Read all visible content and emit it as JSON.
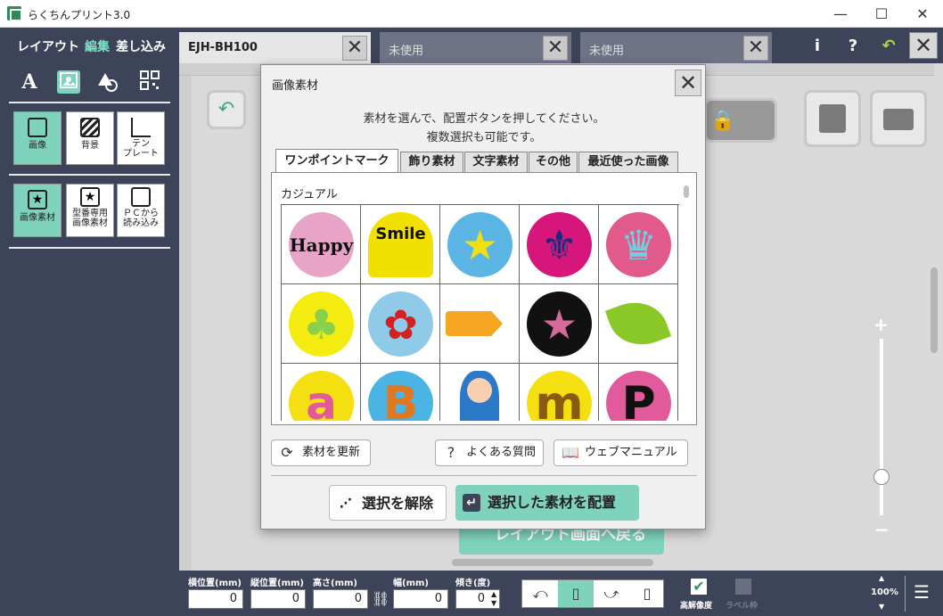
{
  "app": {
    "title": "らくちんプリント3.0"
  },
  "window_controls": {
    "minimize": "—",
    "maximize": "☐",
    "close": "✕"
  },
  "modes": [
    "レイアウト",
    "編集",
    "差し込み"
  ],
  "doc_tabs": [
    {
      "label": "EJH-BH100",
      "active": true
    },
    {
      "label": "未使用",
      "active": false
    },
    {
      "label": "未使用",
      "active": false
    }
  ],
  "top_icons": {
    "info": "i",
    "help": "?",
    "undo": "↶",
    "close": "✕"
  },
  "tools": {
    "text": "A"
  },
  "tiles_row1": [
    {
      "label": "画像",
      "icon": "image-icon",
      "active": true
    },
    {
      "label": "背景",
      "icon": "background-icon",
      "active": false
    },
    {
      "label": "テン\nプレート",
      "icon": "template-icon",
      "active": false
    }
  ],
  "tiles_row2": [
    {
      "label": "画像素材",
      "icon": "star-icon",
      "active": true
    },
    {
      "label": "型番専用\n画像素材",
      "icon": "star-icon",
      "active": false
    },
    {
      "label": "ＰＣから\n読み込み",
      "icon": "pc-icon",
      "active": false
    }
  ],
  "behind_button": "レイアウト画面へ戻る",
  "bottom": {
    "fields": [
      {
        "label": "横位置(mm)",
        "value": "0"
      },
      {
        "label": "縦位置(mm)",
        "value": "0"
      },
      {
        "label": "高さ(mm)",
        "value": "0"
      },
      {
        "label": "幅(mm)",
        "value": "0"
      },
      {
        "label": "傾き(度)",
        "value": "0"
      }
    ],
    "high_res": "高解像度",
    "label_frame": "ラベル枠",
    "zoom": "100%"
  },
  "dialog": {
    "title": "画像素材",
    "close": "✕",
    "instructions": [
      "素材を選んで、配置ボタンを押してください。",
      "複数選択も可能です。"
    ],
    "tabs": [
      "ワンポイントマーク",
      "飾り素材",
      "文字素材",
      "その他",
      "最近使った画像"
    ],
    "category": "カジュアル",
    "items": [
      {
        "name": "happy",
        "text": "Happy",
        "bg": "#e8a4c6",
        "fg": "#111111"
      },
      {
        "name": "smile",
        "text": "Smile",
        "bg": "#f2e000",
        "fg": "#111111"
      },
      {
        "name": "star-blue",
        "text": "★",
        "bg": "#5ab4e4",
        "fg": "#f4e010"
      },
      {
        "name": "fleur",
        "text": "⚜",
        "bg": "#d6167a",
        "fg": "#1a2a7a"
      },
      {
        "name": "crown",
        "text": "♛",
        "bg": "#e05a8c",
        "fg": "#6ed0e0"
      },
      {
        "name": "clover",
        "text": "♣",
        "bg": "#f4ec10",
        "fg": "#8ad04a"
      },
      {
        "name": "hibiscus",
        "text": "✿",
        "bg": "#8fcbe8",
        "fg": "#d42020"
      },
      {
        "name": "tag",
        "text": "",
        "bg": "transparent",
        "fg": "#f0a020"
      },
      {
        "name": "star-pink",
        "text": "★",
        "bg": "#111111",
        "fg": "#d26a9a"
      },
      {
        "name": "leaf",
        "text": "",
        "bg": "transparent",
        "fg": "#8ac828"
      },
      {
        "name": "letter-a",
        "text": "a",
        "bg": "#f4e010",
        "fg": "#e05a9c"
      },
      {
        "name": "letter-b",
        "text": "B",
        "bg": "#4ab4e4",
        "fg": "#e07820"
      },
      {
        "name": "doll",
        "text": "",
        "bg": "transparent",
        "fg": "#2a7ac8"
      },
      {
        "name": "letter-m",
        "text": "m",
        "bg": "#f4e010",
        "fg": "#8a5a10"
      },
      {
        "name": "letter-p",
        "text": "P",
        "bg": "#e05a9c",
        "fg": "#111111"
      }
    ],
    "refresh_button": "素材を更新",
    "faq_button": "よくある質問",
    "manual_button": "ウェブマニュアル",
    "deselect_button": "選択を解除",
    "place_button": "選択した素材を配置"
  }
}
